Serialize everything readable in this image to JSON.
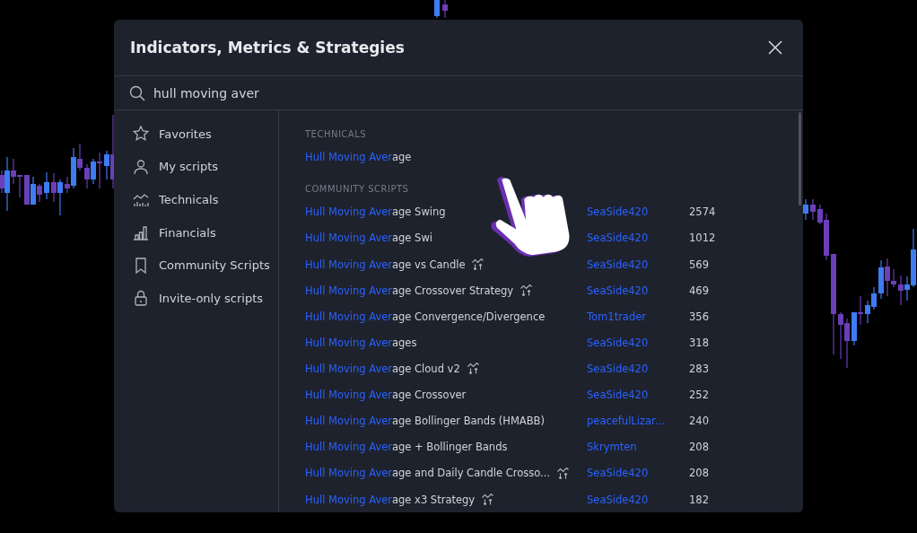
{
  "dialog": {
    "title": "Indicators, Metrics & Strategies"
  },
  "search": {
    "value": "hull moving aver"
  },
  "sidebar": {
    "items": [
      {
        "label": "Favorites"
      },
      {
        "label": "My scripts"
      },
      {
        "label": "Technicals"
      },
      {
        "label": "Financials"
      },
      {
        "label": "Community Scripts"
      },
      {
        "label": "Invite-only scripts"
      }
    ]
  },
  "sections": [
    {
      "heading": "TECHNICALS",
      "rows": [
        {
          "match": "Hull Moving Aver",
          "rest": "age",
          "strategy": false
        }
      ]
    },
    {
      "heading": "COMMUNITY SCRIPTS",
      "rows": [
        {
          "match": "Hull Moving Aver",
          "rest": "age Swing",
          "strategy": false,
          "author": "SeaSide420",
          "count": "2574"
        },
        {
          "match": "Hull Moving Aver",
          "rest": "age Swi",
          "strategy": false,
          "author": "SeaSide420",
          "count": "1012"
        },
        {
          "match": "Hull Moving Aver",
          "rest": "age vs Candle",
          "strategy": true,
          "author": "SeaSide420",
          "count": "569"
        },
        {
          "match": "Hull Moving Aver",
          "rest": "age Crossover Strategy",
          "strategy": true,
          "author": "SeaSide420",
          "count": "469"
        },
        {
          "match": "Hull Moving Aver",
          "rest": "age Convergence/Divergence",
          "strategy": false,
          "author": "Tom1trader",
          "count": "356"
        },
        {
          "match": "Hull Moving Aver",
          "rest": "ages",
          "strategy": false,
          "author": "SeaSide420",
          "count": "318"
        },
        {
          "match": "Hull Moving Aver",
          "rest": "age Cloud v2",
          "strategy": true,
          "author": "SeaSide420",
          "count": "283"
        },
        {
          "match": "Hull Moving Aver",
          "rest": "age Crossover",
          "strategy": false,
          "author": "SeaSide420",
          "count": "252"
        },
        {
          "match": "Hull Moving Aver",
          "rest": "age Bollinger Bands (HMABB)",
          "strategy": false,
          "author": "peacefulLizar...",
          "count": "240"
        },
        {
          "match": "Hull Moving Aver",
          "rest": "age + Bollinger Bands",
          "strategy": false,
          "author": "Skrymten",
          "count": "208"
        },
        {
          "match": "Hull Moving Aver",
          "rest": "age and Daily Candle Crosso...",
          "strategy": true,
          "author": "SeaSide420",
          "count": "208"
        },
        {
          "match": "Hull Moving Aver",
          "rest": "age x3 Strategy",
          "strategy": true,
          "author": "SeaSide420",
          "count": "182"
        }
      ]
    }
  ]
}
